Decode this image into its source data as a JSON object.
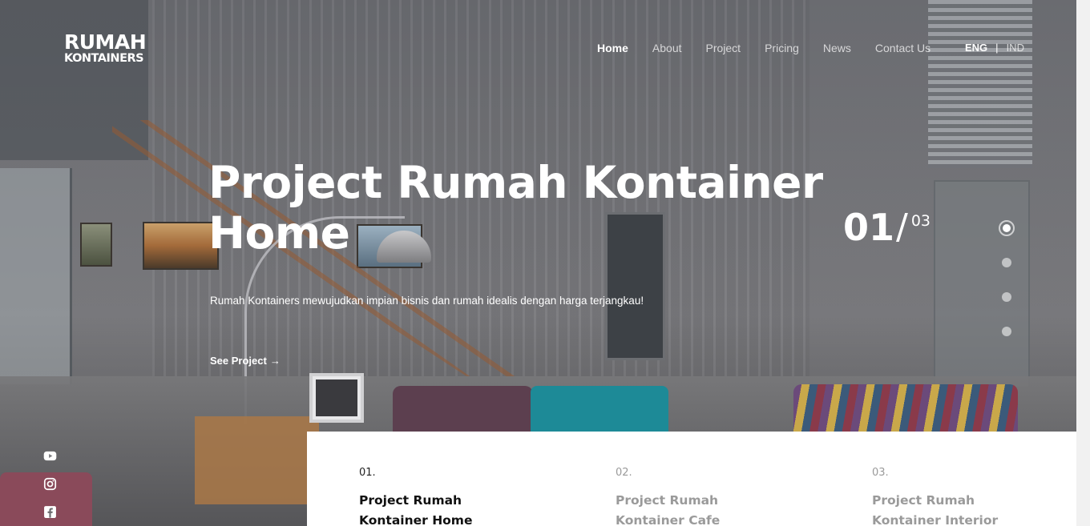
{
  "brand": {
    "line1": "RUMAH",
    "line2": "KONTAINERS"
  },
  "nav": {
    "items": [
      {
        "label": "Home",
        "active": true
      },
      {
        "label": "About"
      },
      {
        "label": "Project"
      },
      {
        "label": "Pricing"
      },
      {
        "label": "News"
      },
      {
        "label": "Contact Us"
      }
    ]
  },
  "lang": {
    "eng": "ENG",
    "separator": "|",
    "ind": "IND",
    "active": "ENG"
  },
  "hero": {
    "title": "Project Rumah Kontainer Home",
    "description": "Rumah Kontainers mewujudkan impian bisnis dan rumah idealis dengan harga terjangkau!",
    "cta": "See Project",
    "cta_arrow": "→"
  },
  "slider": {
    "current": "01",
    "slash": "/",
    "total": "03",
    "dots": 4,
    "active_dot": 1
  },
  "social": {
    "icons": [
      "youtube-icon",
      "instagram-icon",
      "facebook-icon"
    ]
  },
  "projects": [
    {
      "num": "01.",
      "title": "Project Rumah Kontainer Home",
      "active": true
    },
    {
      "num": "02.",
      "title": "Project Rumah Kontainer Cafe",
      "active": false
    },
    {
      "num": "03.",
      "title": "Project Rumah Kontainer Interior",
      "active": false
    }
  ],
  "colors": {
    "text": "#ffffff",
    "muted_card_text": "#9a9a9a",
    "card_bg": "#ffffff"
  }
}
